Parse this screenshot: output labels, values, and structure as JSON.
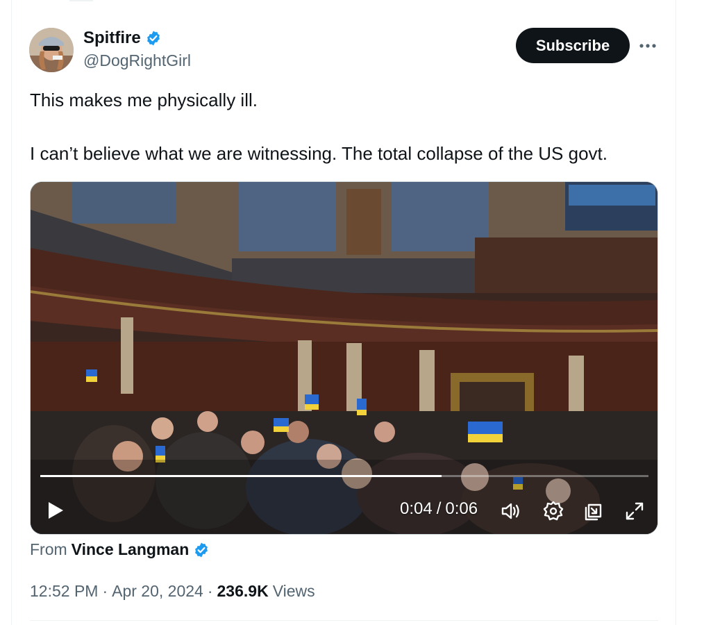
{
  "colors": {
    "accent_blue": "#1d9bf0",
    "text_primary": "#0f1419",
    "text_secondary": "#536471",
    "button_bg": "#0f1419"
  },
  "author": {
    "display_name": "Spitfire",
    "handle": "@DogRightGirl",
    "verified_icon": "verified-badge-icon",
    "avatar_icon": "avatar"
  },
  "actions": {
    "subscribe_label": "Subscribe",
    "more_icon": "more-horizontal-icon"
  },
  "tweet": {
    "paragraphs": [
      "This makes me physically ill.",
      "I can’t believe what we are witnessing. The total collapse of the US govt."
    ]
  },
  "video": {
    "current_time": "0:04",
    "separator": "/",
    "duration": "0:06",
    "progress": 0.66,
    "controls": [
      "play-icon",
      "volume-icon",
      "settings-icon",
      "pip-icon",
      "fullscreen-icon"
    ]
  },
  "attribution": {
    "prefix": "From",
    "source_name": "Vince Langman"
  },
  "meta": {
    "time": "12:52 PM",
    "dot1": "·",
    "date": "Apr 20, 2024",
    "dot2": "·",
    "views_count": "236.9K",
    "views_label": "Views"
  }
}
